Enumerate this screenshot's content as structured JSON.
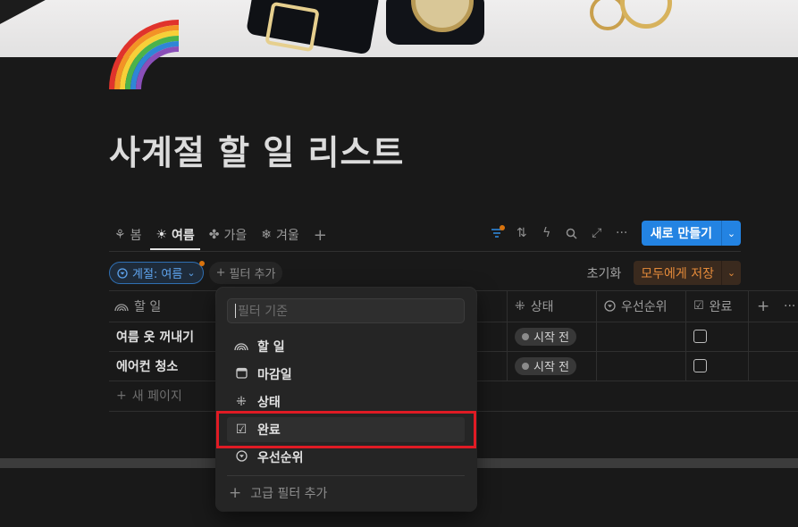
{
  "page": {
    "title": "사계절 할 일 리스트",
    "icon": "rainbow-icon"
  },
  "tabs": [
    {
      "label": "봄",
      "icon": "sprout-icon",
      "glyph": "⚘"
    },
    {
      "label": "여름",
      "icon": "sun-icon",
      "glyph": "☀",
      "active": true
    },
    {
      "label": "가을",
      "icon": "clover-icon",
      "glyph": "✤"
    },
    {
      "label": "겨울",
      "icon": "snowflake-icon",
      "glyph": "❄"
    }
  ],
  "toolbar": {
    "new_label": "새로 만들기"
  },
  "filter": {
    "chip_label": "계절: 여름",
    "add_label": "필터 추가",
    "reset_label": "초기화",
    "save_label": "모두에게 저장"
  },
  "table": {
    "columns": {
      "todo": "할 일",
      "status": "상태",
      "priority": "우선순위",
      "done": "완료"
    },
    "rows": [
      {
        "name": "여름 옷 꺼내기",
        "status": "시작 전",
        "done": false
      },
      {
        "name": "에어컨 청소",
        "status": "시작 전",
        "done": false
      }
    ],
    "new_page_label": "새 페이지"
  },
  "dropdown": {
    "placeholder": "필터 기준",
    "items": [
      {
        "label": "할 일",
        "icon": "rainbow-title-icon"
      },
      {
        "label": "마감일",
        "icon": "calendar-icon"
      },
      {
        "label": "상태",
        "icon": "status-loader-icon"
      },
      {
        "label": "완료",
        "icon": "checkbox-icon",
        "highlighted": true
      },
      {
        "label": "우선순위",
        "icon": "select-icon"
      }
    ],
    "advanced_label": "고급 필터 추가"
  },
  "colors": {
    "accent": "#2383e2",
    "highlight_box": "#e01b24",
    "save": "#e58b3a"
  }
}
